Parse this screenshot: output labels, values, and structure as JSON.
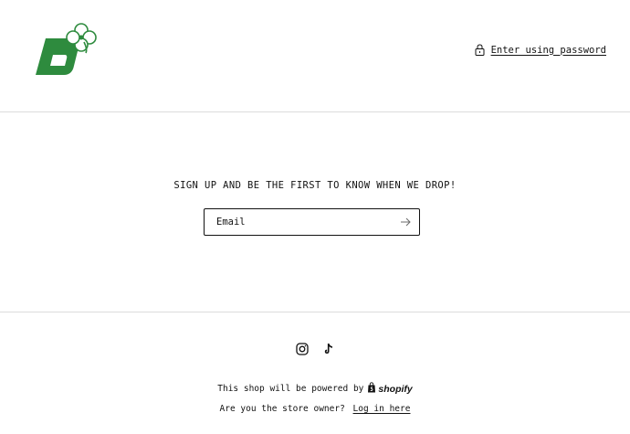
{
  "header": {
    "logo_icon": "clover-brand-logo",
    "password_link_label": "Enter using password",
    "password_icon": "lock-icon"
  },
  "main": {
    "heading": "SIGN UP AND BE THE FIRST TO KNOW WHEN WE DROP!",
    "email_placeholder": "Email",
    "email_value": "",
    "submit_icon": "arrow-right-icon"
  },
  "footer": {
    "socials": [
      {
        "name": "Instagram",
        "icon": "instagram-icon"
      },
      {
        "name": "TikTok",
        "icon": "tiktok-icon"
      }
    ],
    "powered_by_text": "This shop will be powered by",
    "powered_by_brand": "shopify",
    "owner_question": "Are you the store owner?",
    "login_label": "Log in here"
  },
  "colors": {
    "brand_green": "#2e8b3e",
    "text": "#121212",
    "divider": "#dcdcdc",
    "background": "#ffffff"
  }
}
